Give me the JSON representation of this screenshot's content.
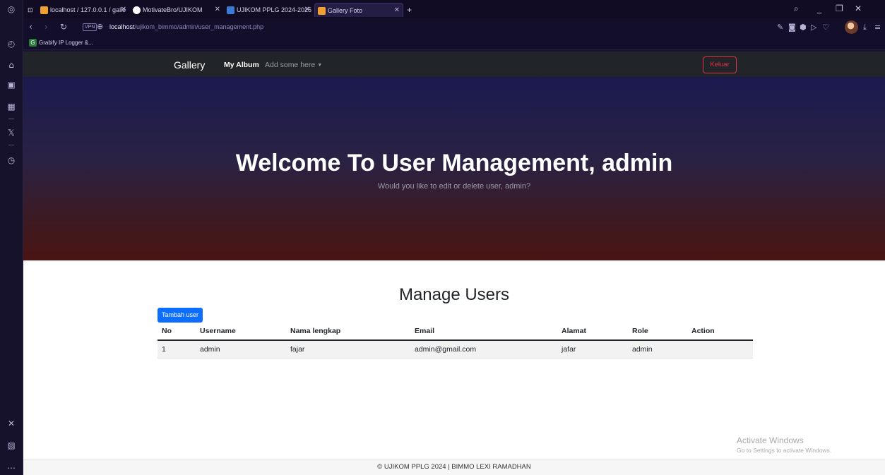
{
  "browser": {
    "tabs": [
      {
        "label": "localhost / 127.0.0.1 / galle",
        "favicon_color": "#f0a030"
      },
      {
        "label": "MotivateBro/UJIKOM",
        "favicon_color": "#ffffff"
      },
      {
        "label": "UJIKOM PPLG 2024-2025 |",
        "favicon_color": "#3a7bd5"
      },
      {
        "label": "Gallery Foto",
        "favicon_color": "#f0a030"
      }
    ],
    "new_tab_label": "+",
    "vpn_label": "VPN",
    "url_host": "localhost",
    "url_path": "/ujikom_bimmo/admin/user_management.php",
    "bookmark_label": "Grabify IP Logger &...",
    "bookmark_icon_letter": "G"
  },
  "navbar": {
    "brand": "Gallery",
    "active_link": "My Album",
    "dropdown_link": "Add some here",
    "logout_label": "Keluar"
  },
  "hero": {
    "title": "Welcome To User Management, admin",
    "subtitle": "Would you like to edit or delete user, admin?"
  },
  "users": {
    "heading": "Manage Users",
    "add_button": "Tambah user",
    "columns": [
      "No",
      "Username",
      "Nama lengkap",
      "Email",
      "Alamat",
      "Role",
      "Action"
    ],
    "rows": [
      [
        "1",
        "admin",
        "fajar",
        "admin@gmail.com",
        "jafar",
        "admin",
        ""
      ]
    ]
  },
  "watermark": {
    "title": "Activate Windows",
    "subtitle": "Go to Settings to activate Windows."
  },
  "footer": {
    "text": "© UJIKOM PPLG 2024 | BIMMO LEXI RAMADHAN"
  },
  "colors": {
    "primary": "#0d6efd",
    "danger": "#dc3545",
    "navbar_bg": "#212529",
    "browser_bg": "#130e2a"
  }
}
